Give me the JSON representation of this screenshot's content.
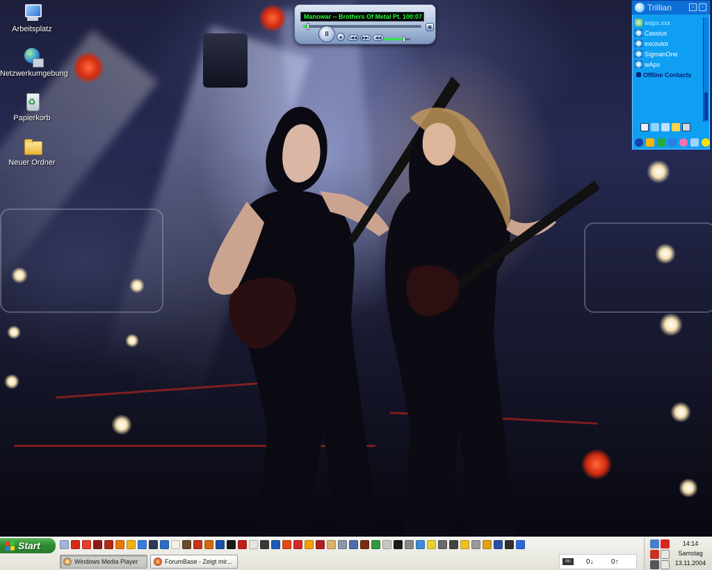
{
  "desktop": {
    "icons": [
      {
        "label": "Arbeitsplatz",
        "icon": "my-computer-icon"
      },
      {
        "label": "Netzwerkumgebung",
        "icon": "network-icon"
      },
      {
        "label": "Papierkorb",
        "icon": "recycle-bin-icon"
      },
      {
        "label": "Neuer Ordner",
        "icon": "folder-icon"
      }
    ]
  },
  "media_player": {
    "track": "Manowar -- Brothers Of Metal Pt. 1",
    "time": "00:07",
    "progress": 0.04,
    "volume": 0.75,
    "buttons": {
      "play": "II",
      "stop": "●",
      "prev": "I◀◀",
      "next": "▶▶I",
      "mute": "◀◀"
    }
  },
  "trillian": {
    "title": "Trillian",
    "contacts": [
      {
        "name": "waps.xxx",
        "status": "away"
      },
      {
        "name": "Cassius",
        "status": "online"
      },
      {
        "name": "excoutor",
        "status": "online"
      },
      {
        "name": "SigmanOne",
        "status": "online"
      },
      {
        "name": "wAps",
        "status": "online"
      }
    ],
    "offline_group": "Offline Contacts"
  },
  "taskbar": {
    "start_label": "Start",
    "tasks": [
      {
        "label": "Windows Media Player",
        "active": true
      },
      {
        "label": "ForumBase - Zeigt mir...",
        "active": false
      }
    ],
    "net_meter": {
      "down": "0↓",
      "up": "0↑"
    },
    "clock": {
      "time": "14:14",
      "day": "Samstag",
      "date": "13.11.2004"
    }
  },
  "colors": {
    "trillian_bg": "#0f9ff2",
    "lcd_text": "#27ff3a",
    "start_green": "#2d8f31"
  }
}
